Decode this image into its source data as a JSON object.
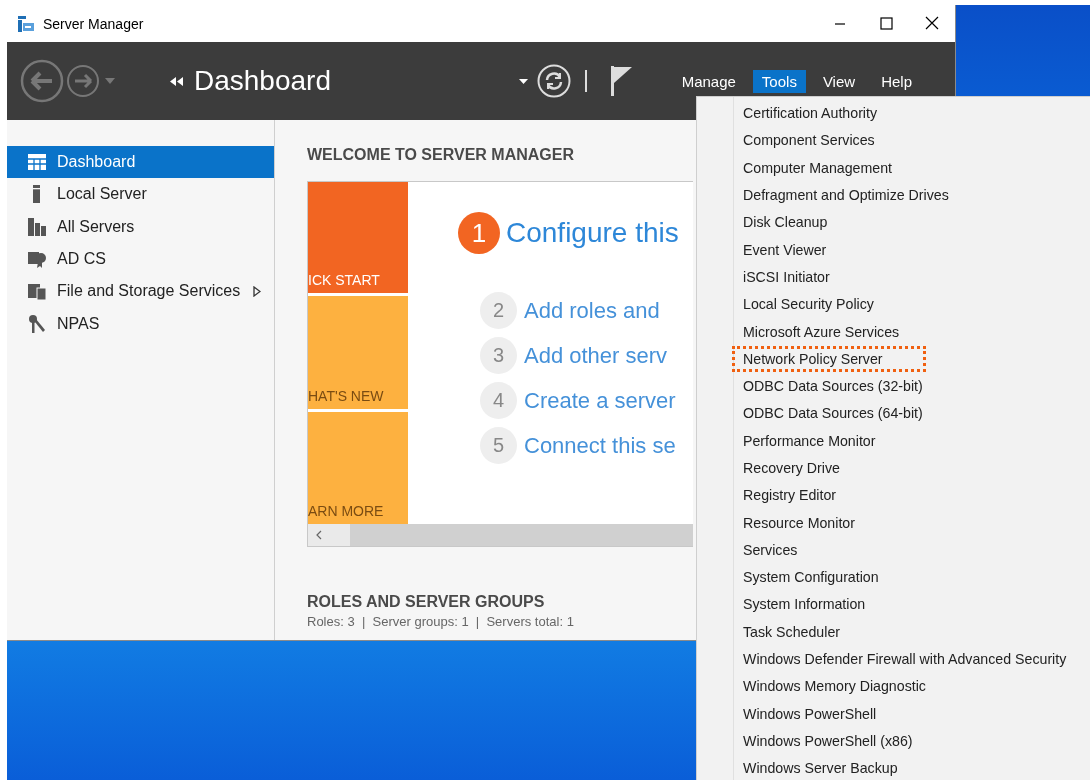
{
  "window": {
    "title": "Server Manager"
  },
  "toolbar": {
    "breadcrumb": "Dashboard",
    "menus": [
      {
        "label": "Manage",
        "selected": false
      },
      {
        "label": "Tools",
        "selected": true
      },
      {
        "label": "View",
        "selected": false
      },
      {
        "label": "Help",
        "selected": false
      }
    ]
  },
  "sidebar": {
    "items": [
      {
        "label": "Dashboard",
        "kind": "dashboard",
        "selected": true,
        "has_submenu": false
      },
      {
        "label": "Local Server",
        "kind": "server",
        "selected": false,
        "has_submenu": false
      },
      {
        "label": "All Servers",
        "kind": "servers",
        "selected": false,
        "has_submenu": false
      },
      {
        "label": "AD CS",
        "kind": "certificate",
        "selected": false,
        "has_submenu": false
      },
      {
        "label": "File and Storage Services",
        "kind": "storage",
        "selected": false,
        "has_submenu": true
      },
      {
        "label": "NPAS",
        "kind": "keys",
        "selected": false,
        "has_submenu": false
      }
    ]
  },
  "dashboard": {
    "heading": "WELCOME TO SERVER MANAGER",
    "tiles": [
      {
        "label": "ICK START",
        "color": "#f26522"
      },
      {
        "label": "HAT'S NEW",
        "color": "#fdb140"
      },
      {
        "label": "ARN MORE",
        "color": "#fdb140"
      }
    ],
    "steps": [
      {
        "number": "1",
        "text": "Configure this",
        "kind": "primary"
      },
      {
        "number": "2",
        "text": "Add roles and",
        "kind": "secondary"
      },
      {
        "number": "3",
        "text": "Add other serv",
        "kind": "secondary"
      },
      {
        "number": "4",
        "text": "Create a server",
        "kind": "secondary"
      },
      {
        "number": "5",
        "text": "Connect this se",
        "kind": "secondary"
      }
    ],
    "roles_heading": "ROLES AND SERVER GROUPS",
    "roles_summary": "Roles: 3  |  Server groups: 1  |  Servers total: 1"
  },
  "tools_menu": {
    "items": [
      {
        "label": "Certification Authority",
        "highlighted": false
      },
      {
        "label": "Component Services",
        "highlighted": false
      },
      {
        "label": "Computer Management",
        "highlighted": false
      },
      {
        "label": "Defragment and Optimize Drives",
        "highlighted": false
      },
      {
        "label": "Disk Cleanup",
        "highlighted": false
      },
      {
        "label": "Event Viewer",
        "highlighted": false
      },
      {
        "label": "iSCSI Initiator",
        "highlighted": false
      },
      {
        "label": "Local Security Policy",
        "highlighted": false
      },
      {
        "label": "Microsoft Azure Services",
        "highlighted": false
      },
      {
        "label": "Network Policy Server",
        "highlighted": true
      },
      {
        "label": "ODBC Data Sources (32-bit)",
        "highlighted": false
      },
      {
        "label": "ODBC Data Sources (64-bit)",
        "highlighted": false
      },
      {
        "label": "Performance Monitor",
        "highlighted": false
      },
      {
        "label": "Recovery Drive",
        "highlighted": false
      },
      {
        "label": "Registry Editor",
        "highlighted": false
      },
      {
        "label": "Resource Monitor",
        "highlighted": false
      },
      {
        "label": "Services",
        "highlighted": false
      },
      {
        "label": "System Configuration",
        "highlighted": false
      },
      {
        "label": "System Information",
        "highlighted": false
      },
      {
        "label": "Task Scheduler",
        "highlighted": false
      },
      {
        "label": "Windows Defender Firewall with Advanced Security",
        "highlighted": false
      },
      {
        "label": "Windows Memory Diagnostic",
        "highlighted": false
      },
      {
        "label": "Windows PowerShell",
        "highlighted": false
      },
      {
        "label": "Windows PowerShell (x86)",
        "highlighted": false
      },
      {
        "label": "Windows Server Backup",
        "highlighted": false
      }
    ]
  }
}
